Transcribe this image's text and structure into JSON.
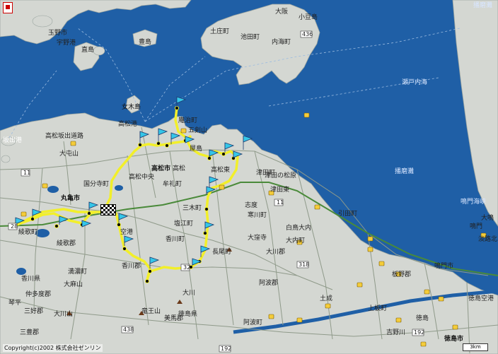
{
  "map": {
    "sea_labels": [
      {
        "name": "sea-label-harima-nada-top",
        "text": "播磨灘"
      },
      {
        "name": "sea-label-setonaikai",
        "text": "瀬戸内海"
      },
      {
        "name": "sea-label-harima-nada",
        "text": "播磨灘"
      },
      {
        "name": "sea-label-naruto-strait",
        "text": "鳴門海峡"
      }
    ],
    "place_labels": [
      {
        "name": "label-osaka-ferry-top",
        "text": "大阪"
      },
      {
        "name": "label-shodoshima",
        "text": "小豆島"
      },
      {
        "name": "label-tonosho",
        "text": "土庄町"
      },
      {
        "name": "label-ikeda",
        "text": "池田町"
      },
      {
        "name": "label-uchinomi",
        "text": "内海町"
      },
      {
        "name": "label-tamano",
        "text": "玉野市"
      },
      {
        "name": "label-uno-port",
        "text": "宇野港"
      },
      {
        "name": "label-naoshima",
        "text": "直島"
      },
      {
        "name": "label-teshima",
        "text": "豊島"
      },
      {
        "name": "label-megijima",
        "text": "女木島"
      },
      {
        "name": "label-takamatsu-port",
        "text": "高松港"
      },
      {
        "name": "label-goken-yama",
        "text": "五剣山"
      },
      {
        "name": "label-sakaide-port",
        "text": "坂出港"
      },
      {
        "name": "label-takamatsu-sakaide-road",
        "text": "高松坂出道路"
      },
      {
        "name": "label-omiyama",
        "text": "大屯山"
      },
      {
        "name": "label-takamatsu-city",
        "text": "高松市"
      },
      {
        "name": "label-takamatsu",
        "text": "高松"
      },
      {
        "name": "label-takamatsu-chuo",
        "text": "高松中央"
      },
      {
        "name": "label-takamatsu-higashi",
        "text": "高松東"
      },
      {
        "name": "label-mure",
        "text": "牟礼町"
      },
      {
        "name": "label-tsuda-higashi",
        "text": "津田東"
      },
      {
        "name": "label-tsuda",
        "text": "津田町"
      },
      {
        "name": "label-shido",
        "text": "志度"
      },
      {
        "name": "label-marugame",
        "text": "丸亀市"
      },
      {
        "name": "label-ayauta",
        "text": "綾歌町"
      },
      {
        "name": "label-ayauta-gun",
        "text": "綾歌郡"
      },
      {
        "name": "label-airport",
        "text": "空港"
      },
      {
        "name": "label-kagawa-gun",
        "text": "香川郡"
      },
      {
        "name": "label-kagawa-cho",
        "text": "香川町"
      },
      {
        "name": "label-shionoe",
        "text": "塩江町"
      },
      {
        "name": "label-okawa-gun",
        "text": "大川郡"
      },
      {
        "name": "label-shiratori",
        "text": "白鳥大内"
      },
      {
        "name": "label-hiketa",
        "text": "引田町"
      },
      {
        "name": "label-okubo",
        "text": "大窪寺"
      },
      {
        "name": "label-mitoyo",
        "text": "三豊郡"
      },
      {
        "name": "label-nakatado",
        "text": "仲多度郡"
      },
      {
        "name": "label-kotohira",
        "text": "琴平"
      },
      {
        "name": "label-ohkawa-yama",
        "text": "大川山"
      },
      {
        "name": "label-ryuo-zan",
        "text": "竜王山"
      },
      {
        "name": "label-awa-gun",
        "text": "阿波郡"
      },
      {
        "name": "label-tokushima-pref",
        "text": "徳島県"
      },
      {
        "name": "label-itano",
        "text": "板野郡"
      },
      {
        "name": "label-naruto-city",
        "text": "鳴門市"
      },
      {
        "name": "label-naruto",
        "text": "鳴門"
      },
      {
        "name": "label-tokushima-airport",
        "text": "徳島空港"
      },
      {
        "name": "label-tokushima-city",
        "text": "徳島市"
      },
      {
        "name": "label-awaji-north",
        "text": "淡路北"
      },
      {
        "name": "label-ohkawa",
        "text": "大川"
      },
      {
        "name": "label-awaji-kita",
        "text": "大鳴"
      },
      {
        "name": "label-mima",
        "text": "美馬郡"
      },
      {
        "name": "label-yoshinogawa",
        "text": "吉野川"
      },
      {
        "name": "label-kamiita",
        "text": "上板町"
      },
      {
        "name": "label-donari",
        "text": "土成"
      },
      {
        "name": "label-awa-city",
        "text": "阿波町"
      },
      {
        "name": "label-ikeda-gun",
        "text": "三好郡"
      },
      {
        "name": "label-tokushima-kencho",
        "text": "徳島"
      },
      {
        "name": "label-mt-konpira",
        "text": "大麻山"
      },
      {
        "name": "label-kagawa-kencho",
        "text": "香川県"
      },
      {
        "name": "label-manno",
        "text": "満濃町"
      },
      {
        "name": "label-yashima",
        "text": "屋島"
      },
      {
        "name": "label-aji",
        "text": "庵治町"
      },
      {
        "name": "label-kokubunji",
        "text": "国分寺町"
      },
      {
        "name": "label-miki",
        "text": "三木町"
      },
      {
        "name": "label-nagao",
        "text": "長尾町"
      },
      {
        "name": "label-samukawa",
        "text": "寒川町"
      },
      {
        "name": "label-ohchi",
        "text": "大内町"
      },
      {
        "name": "label-tsuda-matsu",
        "text": "津田の松原"
      }
    ],
    "route_numbers": [
      {
        "name": "route-436",
        "text": "436"
      },
      {
        "name": "route-11-west",
        "text": "11"
      },
      {
        "name": "route-11-east",
        "text": "11"
      },
      {
        "name": "route-318",
        "text": "318"
      },
      {
        "name": "route-438",
        "text": "438"
      },
      {
        "name": "route-192",
        "text": "192"
      },
      {
        "name": "route-192-east",
        "text": "192"
      },
      {
        "name": "route-32",
        "text": "32"
      },
      {
        "name": "route-28",
        "text": "28"
      }
    ],
    "copyright": "Copyright(c)2002 株式会社ゼンリン",
    "scale_label": "3km",
    "colors": {
      "sea": "#1f5fa6",
      "land": "#d4d7d2",
      "route": "#f2ef2a",
      "road": "#8f9a8a",
      "flag": "#35c6e8"
    }
  }
}
